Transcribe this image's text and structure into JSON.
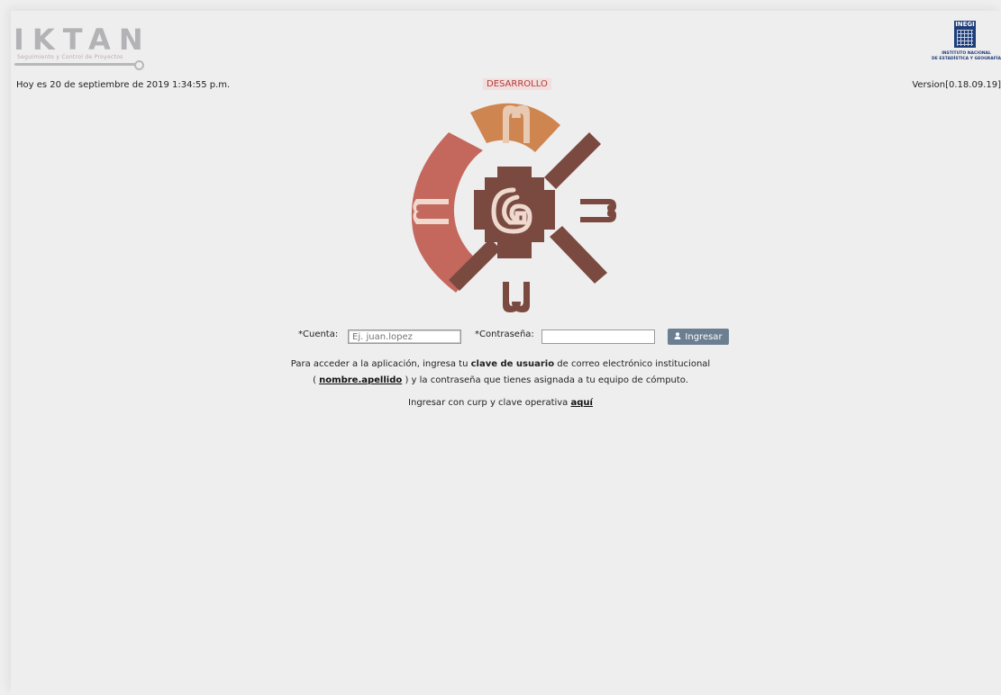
{
  "header": {
    "logo_text": "IKTAN",
    "logo_subtitle": "Seguimiento y Control de Proyectos",
    "date_text": "Hoy es 20 de septiembre de 2019 1:34:55 p.m.",
    "environment_badge": "DESARROLLO",
    "version_text": "Version[0.18.09.19]",
    "inegi_logo_text": "INEGI",
    "inegi_caption_line1": "INSTITUTO NACIONAL",
    "inegi_caption_line2": "DE ESTADÍSTICA Y GEOGRAFÍA"
  },
  "login": {
    "account_label": "*Cuenta:",
    "account_placeholder": "Ej. juan.lopez",
    "account_value": "",
    "password_label": "*Contraseña:",
    "password_value": "",
    "submit_label": "Ingresar"
  },
  "info": {
    "line1_prefix": "Para acceder a la aplicación, ingresa tu",
    "line1_bold": "clave de usuario",
    "line1_suffix": "de correo electrónico institucional",
    "line2_open": "(",
    "line2_link": "nombre.apellido",
    "line2_suffix": ") y la contraseña que tienes asignada a tu equipo de cómputo.",
    "line3_prefix": "Ingresar con curp y clave operativa",
    "line3_link": "aquí"
  },
  "colors": {
    "button_bg": "#6c7e91",
    "badge_text": "#b03a3a",
    "emblem_red": "#c4685d",
    "emblem_orange": "#cf8550",
    "emblem_brown": "#7a4a40"
  },
  "icons": {
    "submit_icon": "user-icon"
  }
}
